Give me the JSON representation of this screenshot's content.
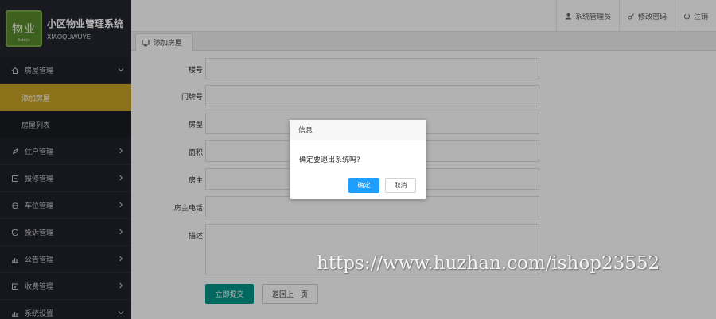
{
  "brand": {
    "logo_text": "物业",
    "logo_sub": "Estate",
    "title": "小区物业管理系统",
    "subtitle": "XIAOQUWUYE"
  },
  "header": {
    "user_label": "系统管理员",
    "password_label": "修改密码",
    "logout_label": "注销"
  },
  "sidebar": {
    "groups": [
      {
        "label": "房屋管理",
        "icon": "house-icon",
        "expanded": true,
        "children": [
          {
            "label": "添加房屋",
            "active": true
          },
          {
            "label": "房屋列表",
            "active": false
          }
        ]
      },
      {
        "label": "住户管理",
        "icon": "rocket-icon"
      },
      {
        "label": "报修管理",
        "icon": "repair-icon"
      },
      {
        "label": "车位管理",
        "icon": "car-icon"
      },
      {
        "label": "投诉管理",
        "icon": "shield-icon"
      },
      {
        "label": "公告管理",
        "icon": "bar-chart-icon"
      },
      {
        "label": "收费管理",
        "icon": "money-icon"
      },
      {
        "label": "系统设置",
        "icon": "settings-chart-icon"
      }
    ]
  },
  "tabs": [
    {
      "label": "添加房屋"
    }
  ],
  "form": {
    "fields": [
      {
        "label": "楼号",
        "value": ""
      },
      {
        "label": "门牌号",
        "value": ""
      },
      {
        "label": "房型",
        "value": ""
      },
      {
        "label": "面积",
        "value": ""
      },
      {
        "label": "房主",
        "value": ""
      },
      {
        "label": "房主电话",
        "value": ""
      },
      {
        "label": "描述",
        "value": ""
      }
    ],
    "submit_label": "立即提交",
    "back_label": "返回上一页"
  },
  "dialog": {
    "title": "信息",
    "message": "确定要退出系统吗?",
    "ok_label": "确定",
    "cancel_label": "取消"
  },
  "watermark": "https://www.huzhan.com/ishop23552",
  "colors": {
    "sidebar_bg": "#20222a",
    "active_item": "#c9a227",
    "primary": "#009688",
    "dialog_ok": "#1e9fff"
  }
}
